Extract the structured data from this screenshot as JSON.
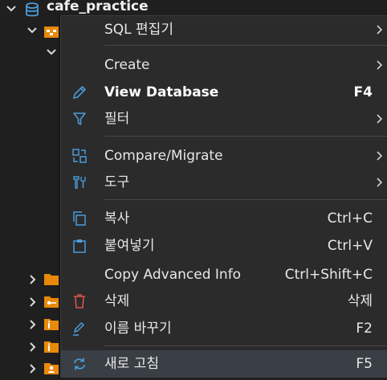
{
  "tree": {
    "connection_name": "cafe_practice"
  },
  "menu": {
    "items": [
      {
        "label": "SQL 편집기",
        "shortcut": "",
        "icon": "none",
        "submenu": true
      },
      {
        "label": "Create",
        "shortcut": "",
        "icon": "none",
        "submenu": true
      },
      {
        "label": "View Database",
        "shortcut": "F4",
        "icon": "pencil-icon",
        "submenu": false
      },
      {
        "label": "필터",
        "shortcut": "",
        "icon": "filter-icon",
        "submenu": true
      },
      {
        "label": "Compare/Migrate",
        "shortcut": "",
        "icon": "compare-icon",
        "submenu": true
      },
      {
        "label": "도구",
        "shortcut": "",
        "icon": "tools-icon",
        "submenu": true
      },
      {
        "label": "복사",
        "shortcut": "Ctrl+C",
        "icon": "copy-icon",
        "submenu": false
      },
      {
        "label": "붙여넣기",
        "shortcut": "Ctrl+V",
        "icon": "paste-icon",
        "submenu": false
      },
      {
        "label": "Copy Advanced Info",
        "shortcut": "Ctrl+Shift+C",
        "icon": "none",
        "submenu": false
      },
      {
        "label": "삭제",
        "shortcut": "삭제",
        "icon": "trash-icon",
        "submenu": false
      },
      {
        "label": "이름 바꾸기",
        "shortcut": "F2",
        "icon": "rename-icon",
        "submenu": false
      },
      {
        "label": "새로 고침",
        "shortcut": "F5",
        "icon": "refresh-icon",
        "submenu": false
      }
    ]
  },
  "colors": {
    "menu_bg": "#2b2b2b",
    "tree_bg": "#1f1f1f",
    "icon_blue": "#4a9bd9",
    "icon_orange": "#e8890c",
    "icon_red": "#d9534f",
    "highlight": "#3a3f45"
  }
}
